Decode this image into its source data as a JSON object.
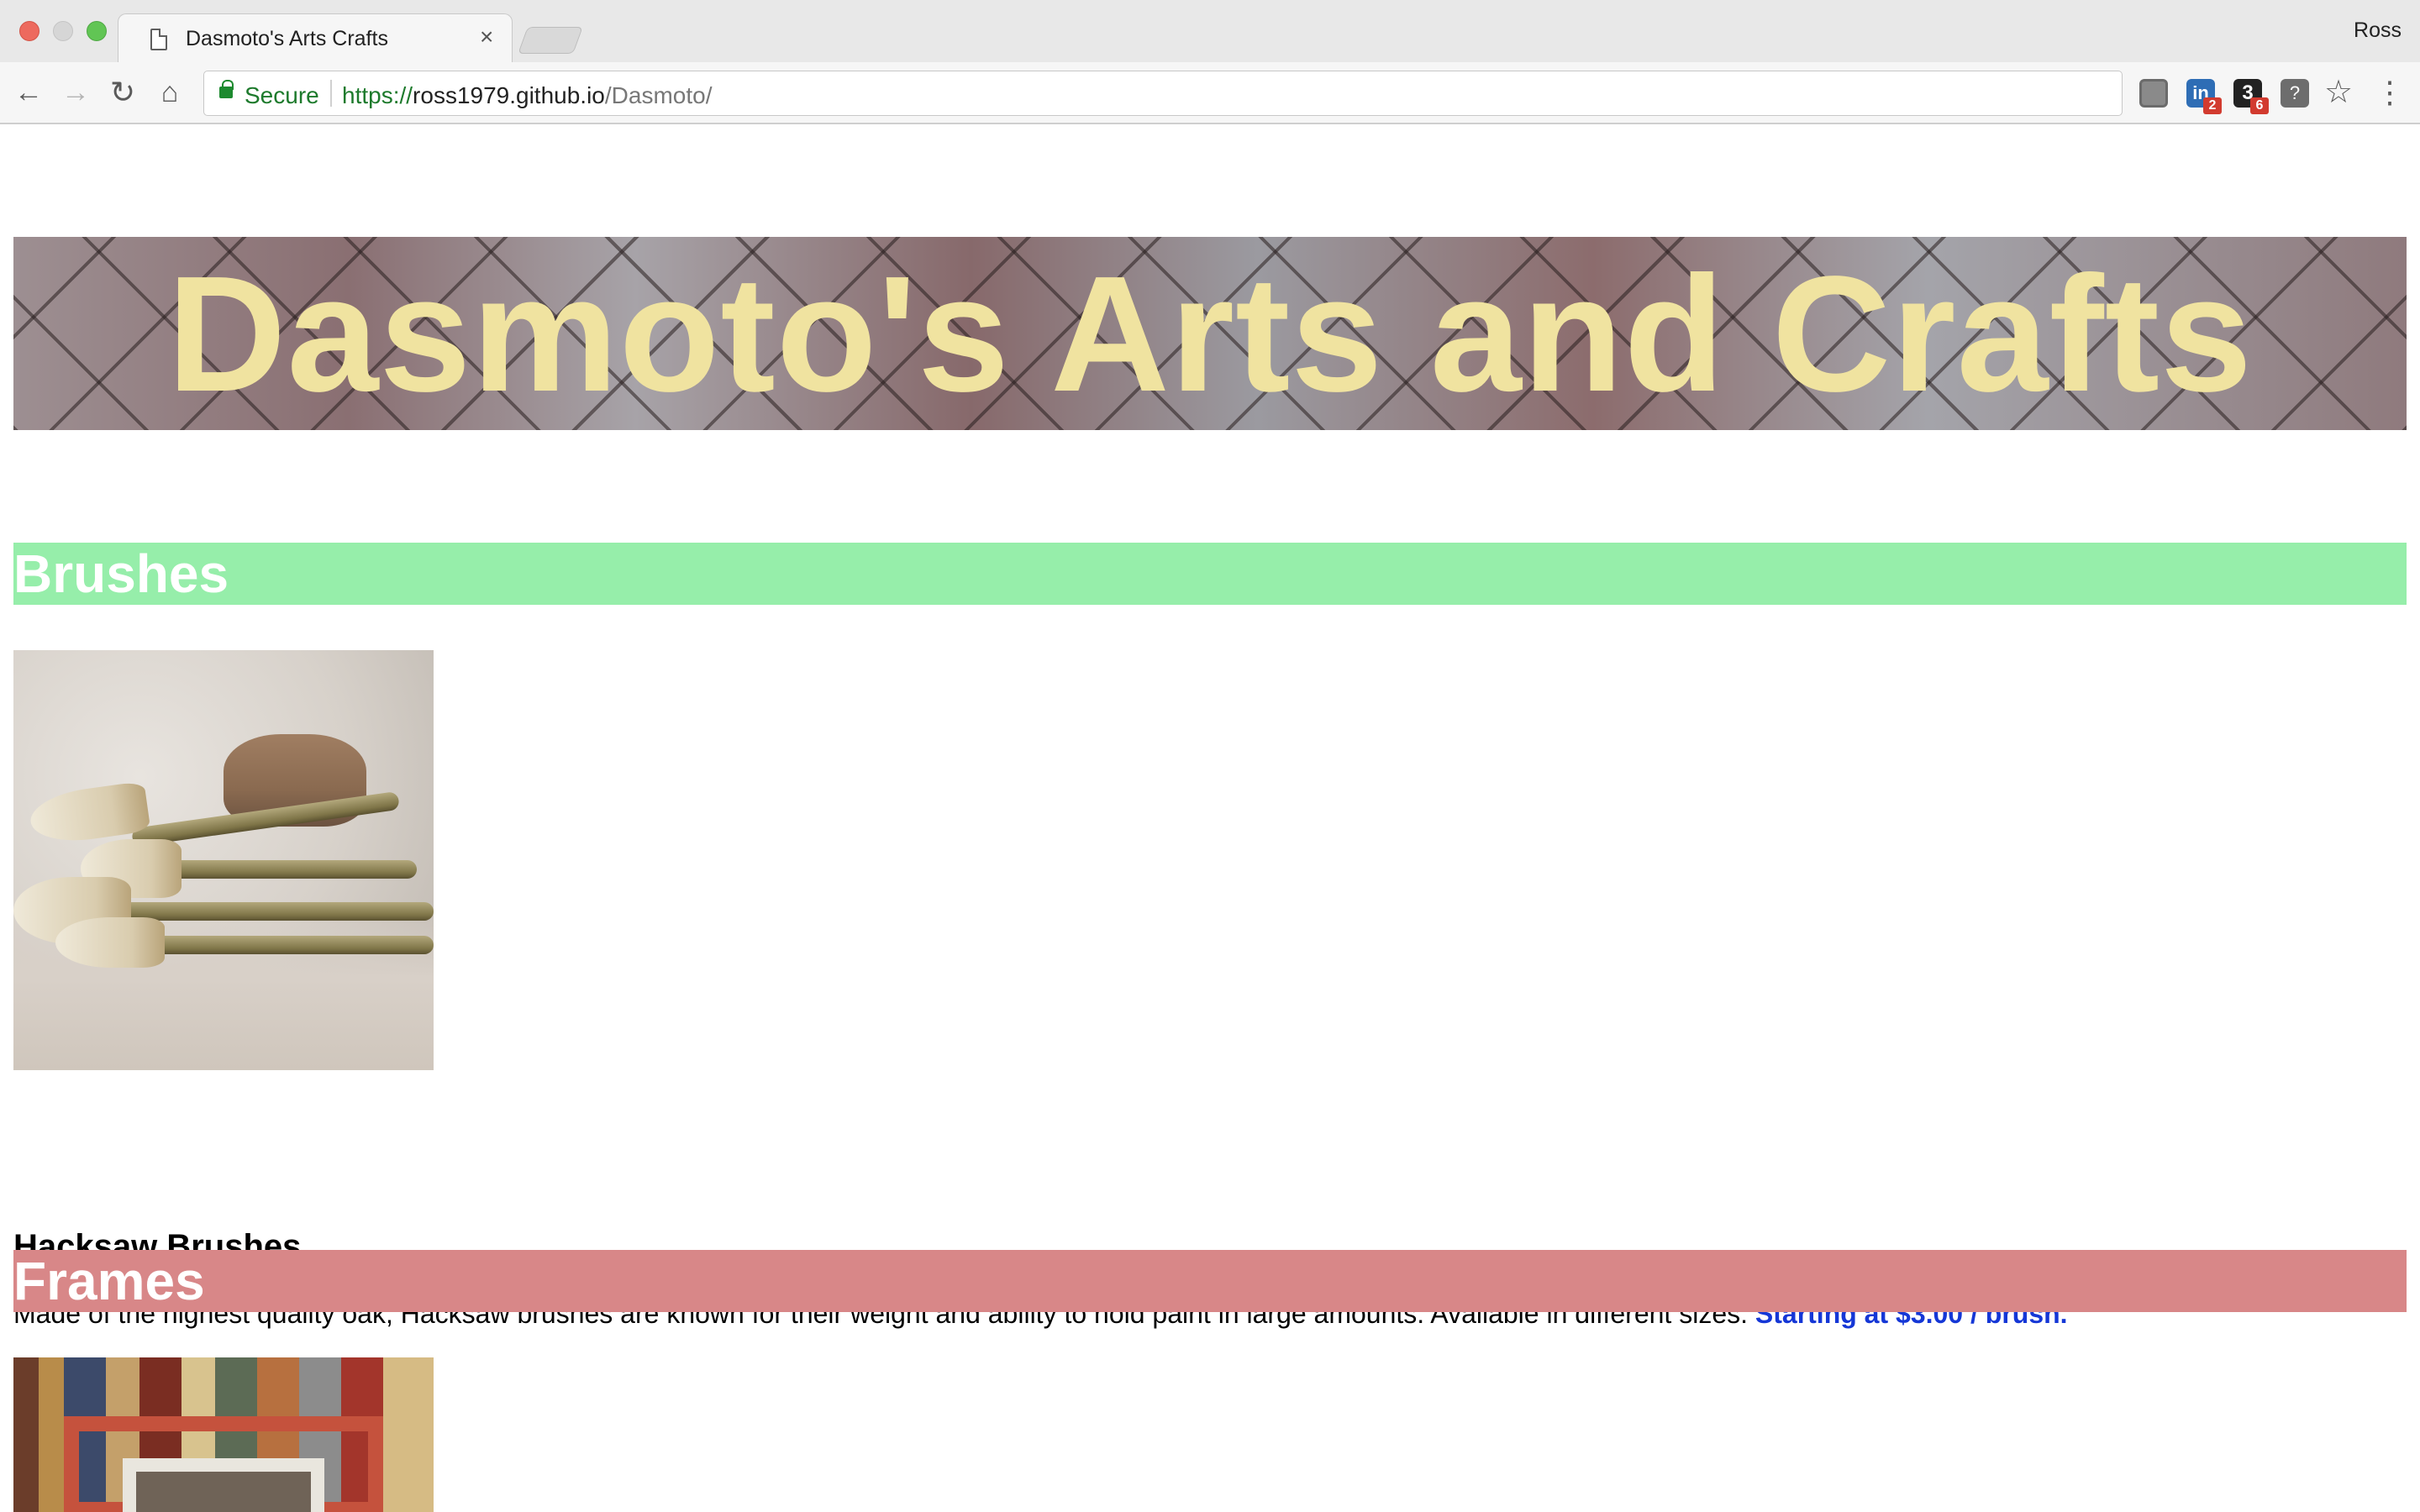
{
  "browser": {
    "tab_title": "Dasmoto's Arts Crafts",
    "tab_close": "×",
    "profile_name": "Ross",
    "security_label": "Secure",
    "url_scheme": "https://",
    "url_host": "ross1979.github.io",
    "url_path": "/Dasmoto/",
    "extensions": [
      {
        "icon": "extension-grey-icon",
        "badge": ""
      },
      {
        "icon": "linkedin-icon",
        "label": "in",
        "badge": "2"
      },
      {
        "icon": "extension-3-icon",
        "label": "3",
        "badge": "6"
      },
      {
        "icon": "lightbulb-icon",
        "label": "?",
        "badge": ""
      }
    ],
    "icons": {
      "back": "←",
      "forward": "→",
      "reload": "↻",
      "home": "⌂",
      "star": "☆",
      "menu": "⋮"
    }
  },
  "page": {
    "header_title": "Dasmoto's Arts and Crafts",
    "sections": [
      {
        "heading": "Brushes",
        "color": "#96eeaa",
        "product_title": "Hacksaw Brushes",
        "description": "Made of the highest quality oak, Hacksaw brushes are known for their weight and ability to hold paint in large amounts. Available in different sizes.",
        "price": "Starting at $3.00 / brush.",
        "price_color": "#1537d6"
      },
      {
        "heading": "Frames",
        "color": "#d88788"
      }
    ],
    "header_text_color": "#f0e3a0"
  }
}
